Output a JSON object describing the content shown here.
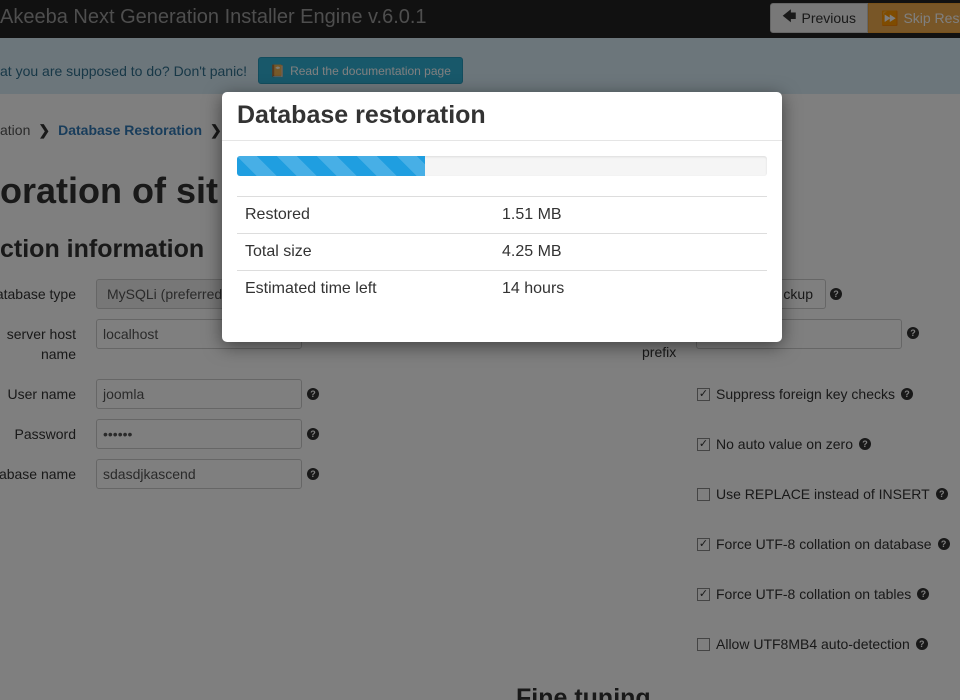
{
  "header": {
    "title": "Akeeba Next Generation Installer Engine v.6.0.1",
    "previous_label": "Previous",
    "skip_label": "Skip Resto"
  },
  "infobar": {
    "question": "at you are supposed to do? Don't panic!",
    "docs_label": "Read the documentation page"
  },
  "breadcrumb": {
    "prev": "ation",
    "current": "Database Restoration"
  },
  "page_title": "oration of sit",
  "section_title": "ction information",
  "form": {
    "db_type_label": "atabase type",
    "db_type_value": "MySQLi (preferred)",
    "host_label_line1": "server host",
    "host_label_line2": "name",
    "host_value": "localhost",
    "user_label": "User name",
    "user_value": "joomla",
    "password_label": "Password",
    "password_value": "••••••",
    "dbname_label": "abase name",
    "dbname_value": "sdasdjkascend",
    "backup_label": "ckup",
    "prefix_label": "prefix"
  },
  "options": [
    {
      "label": "Suppress foreign key checks",
      "checked": true
    },
    {
      "label": "No auto value on zero",
      "checked": true
    },
    {
      "label": "Use REPLACE instead of INSERT",
      "checked": false
    },
    {
      "label": "Force UTF-8 collation on database",
      "checked": true
    },
    {
      "label": "Force UTF-8 collation on tables",
      "checked": true
    },
    {
      "label": "Allow UTF8MB4 auto-detection",
      "checked": false
    }
  ],
  "fine_tuning_title": "Fine tuning",
  "modal": {
    "title": "Database restoration",
    "progress_percent": 35.5,
    "rows": [
      {
        "label": "Restored",
        "value": "1.51 MB"
      },
      {
        "label": "Total size",
        "value": "4.25 MB"
      },
      {
        "label": "Estimated time left",
        "value": "14 hours"
      }
    ]
  }
}
